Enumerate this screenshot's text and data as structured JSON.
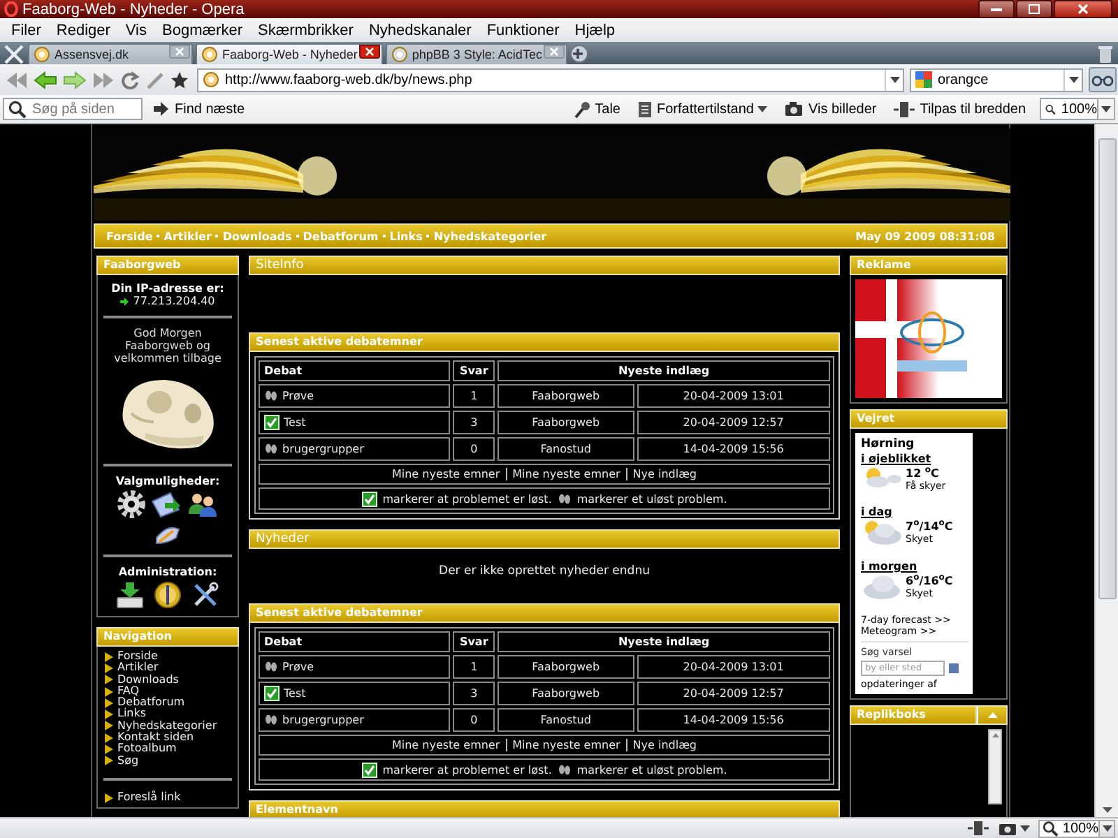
{
  "window": {
    "title": "Faaborg-Web - Nyheder - Opera"
  },
  "menu": [
    "Filer",
    "Rediger",
    "Vis",
    "Bogmærker",
    "Skærmbrikker",
    "Nyhedskanaler",
    "Funktioner",
    "Hjælp"
  ],
  "tabs": [
    {
      "label": "Assensvej.dk",
      "selected": false
    },
    {
      "label": "Faaborg-Web - Nyheder",
      "selected": true
    },
    {
      "label": "phpBB 3 Style: AcidTec",
      "selected": false
    }
  ],
  "address_bar": {
    "url": "http://www.faaborg-web.dk/by/news.php"
  },
  "search_field": {
    "value": "orangce"
  },
  "find_bar": {
    "placeholder": "Søg på siden",
    "find_next": "Find næste",
    "tools": [
      "Tale",
      "Forfattertilstand",
      "Vis billeder",
      "Tilpas til bredden"
    ],
    "zoom": "100%"
  },
  "page": {
    "nav_links": [
      "Forside",
      "Artikler",
      "Downloads",
      "Debatforum",
      "Links",
      "Nyhedskategorier"
    ],
    "date": "May 09 2009 08:31:08",
    "left": {
      "user_panel": {
        "title": "Faaborgweb",
        "ip_label": "Din IP-adresse er:",
        "ip": "77.213.204.40",
        "greeting": "God Morgen Faaborgweb og velkommen tilbage",
        "options_title": "Valgmuligheder:",
        "admin_title": "Administration:"
      },
      "navigation": {
        "title": "Navigation",
        "items": [
          "Forside",
          "Artikler",
          "Downloads",
          "FAQ",
          "Debatforum",
          "Links",
          "Nyhedskategorier",
          "Kontakt siden",
          "Fotoalbum",
          "Søg"
        ],
        "more_items": [
          "Foreslå link"
        ]
      }
    },
    "middle": [
      {
        "kind": "siteinfo",
        "title": "SiteInfo"
      },
      {
        "kind": "forum",
        "title": "Senest aktive debatemner",
        "columns": [
          "Debat",
          "Svar",
          "Nyeste indlæg"
        ],
        "rows": [
          {
            "topic": "Prøve",
            "solved": false,
            "replies": "1",
            "author": "Faaborgweb",
            "date": "20-04-2009 13:01"
          },
          {
            "topic": "Test",
            "solved": true,
            "replies": "3",
            "author": "Faaborgweb",
            "date": "20-04-2009 12:57"
          },
          {
            "topic": "brugergrupper",
            "solved": false,
            "replies": "0",
            "author": "Fanostud",
            "date": "14-04-2009 15:56"
          }
        ],
        "links": [
          "Mine nyeste emner",
          "Mine nyeste emner",
          "Nye indlæg"
        ],
        "legend": {
          "solved": "markerer at problemet er løst.",
          "unsolved": "markerer et uløst problem."
        }
      },
      {
        "kind": "news",
        "title": "Nyheder",
        "message": "Der er ikke oprettet nyheder endnu"
      },
      {
        "kind": "forum",
        "title": "Senest aktive debatemner",
        "columns": [
          "Debat",
          "Svar",
          "Nyeste indlæg"
        ],
        "rows": [
          {
            "topic": "Prøve",
            "solved": false,
            "replies": "1",
            "author": "Faaborgweb",
            "date": "20-04-2009 13:01"
          },
          {
            "topic": "Test",
            "solved": true,
            "replies": "3",
            "author": "Faaborgweb",
            "date": "20-04-2009 12:57"
          },
          {
            "topic": "brugergrupper",
            "solved": false,
            "replies": "0",
            "author": "Fanostud",
            "date": "14-04-2009 15:56"
          }
        ],
        "links": [
          "Mine nyeste emner",
          "Mine nyeste emner",
          "Nye indlæg"
        ],
        "legend": {
          "solved": "markerer at problemet er løst.",
          "unsolved": "markerer et uløst problem."
        }
      },
      {
        "kind": "empty",
        "title": "Elementnavn"
      }
    ],
    "right": {
      "ad": {
        "title": "Reklame"
      },
      "weather": {
        "title": "Vejret",
        "location": "Hørning",
        "periods": [
          {
            "label": "i øjeblikket",
            "temp": "12 $^{o}$C",
            "desc": "Få skyer"
          },
          {
            "label": "i dag",
            "temp": "7$^{o}$/14$^{o}$C",
            "desc": "Skyet"
          },
          {
            "label": "i morgen",
            "temp": "6$^{o}$/16$^{o}$C",
            "desc": "Skyet"
          }
        ],
        "links": [
          "7-day forecast >>",
          "Meteogram >>"
        ],
        "search_label": "Søg varsel",
        "search_placeholder": "by eller sted",
        "footer": "opdateringer af"
      },
      "shoutbox": {
        "title": "Replikboks"
      }
    }
  },
  "status_bar": {
    "zoom": "100%"
  }
}
